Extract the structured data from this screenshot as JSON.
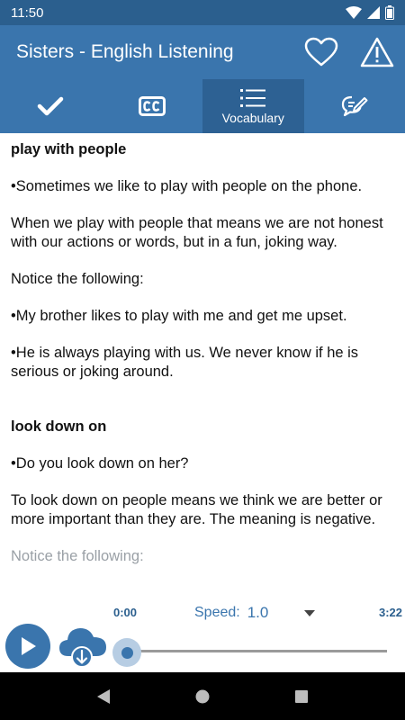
{
  "status_bar": {
    "time": "11:50"
  },
  "app_bar": {
    "title": "Sisters - English Listening"
  },
  "tabs": [
    {
      "name": "check",
      "label": ""
    },
    {
      "name": "cc",
      "label": ""
    },
    {
      "name": "vocabulary",
      "label": "Vocabulary"
    },
    {
      "name": "notes",
      "label": ""
    }
  ],
  "content": {
    "term1": "play with people",
    "t1_example": "•Sometimes we like to play with people on the phone.",
    "t1_def": "When we play with people that means we are not honest with our actions or words, but in a fun, joking way.",
    "t1_notice": "Notice the following:",
    "t1_ex2": "•My brother likes to play with me and get me upset.",
    "t1_ex3": "•He is always playing with us. We never know if he is serious or joking around.",
    "term2": "look down on",
    "t2_example": "•Do you look down on her?",
    "t2_def": "To look down on people means we think we are better or more important than they are.  The meaning is negative.",
    "t2_more": "Notice the following:"
  },
  "player": {
    "time_start": "0:00",
    "time_end": "3:22",
    "speed_label": "Speed:",
    "speed_value": "1.0",
    "progress": 0.0
  },
  "colors": {
    "primary": "#3a75ad",
    "primary_dark": "#2b5f8e",
    "tab_active": "#2d6193"
  }
}
